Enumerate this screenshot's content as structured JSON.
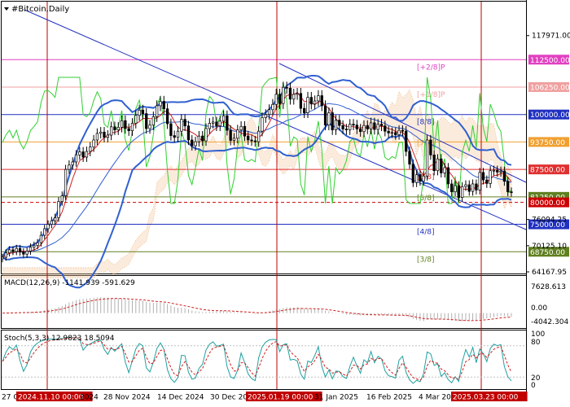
{
  "chart_data": {
    "type": "candlestick",
    "symbol_label": "#Bitcoin,Daily",
    "y_range": [
      64167.95,
      122000
    ],
    "price_ticks": [
      "117971.00",
      "76094.25",
      "70125.10",
      "64167.95"
    ],
    "murrey_levels": [
      {
        "value": 112500,
        "label": "112500.00",
        "tag": "[+2/8]P",
        "color": "#e040c0",
        "dash": false
      },
      {
        "value": 106250,
        "label": "106250.00",
        "tag": "[+1/8]P",
        "color": "#f0a0a0",
        "dash": false
      },
      {
        "value": 100000,
        "label": "100000.00",
        "tag": "[8/8]",
        "color": "#2030c0",
        "dash": false
      },
      {
        "value": 93750,
        "label": "93750.00",
        "tag": "[7/8]",
        "color": "#f0a030",
        "dash": false
      },
      {
        "value": 87500,
        "label": "87500.00",
        "tag": "[6/8]",
        "color": "#e03030",
        "dash": false
      },
      {
        "value": 81250,
        "label": "81250.00",
        "tag": "[5/8]",
        "color": "#608020",
        "dash": false
      },
      {
        "value": 80000,
        "label": "80000.00",
        "tag": "",
        "color": "#cc0000",
        "dash": true
      },
      {
        "value": 75000,
        "label": "75000.00",
        "tag": "[4/8]",
        "color": "#2030c0",
        "dash": false
      },
      {
        "value": 68750,
        "label": "68750.00",
        "tag": "[3/8]",
        "color": "#608020",
        "dash": false
      }
    ],
    "current_price_label": "81250.00",
    "macd": {
      "label": "MACD(12,26,9) -1141.939 -591.629",
      "ticks": [
        "7628.613",
        "0.00",
        "-4042.304"
      ],
      "range": [
        -4042.304,
        7628.613
      ]
    },
    "stoch": {
      "label": "Stoch(5,3,3) 12.9823 18.5094",
      "ticks": [
        "100",
        "80",
        "20",
        "0"
      ]
    },
    "x_labels": [
      "27 O",
      "2024.11.10 00:00",
      "2024",
      "28 Nov 2024",
      "14 Dec 2024",
      "30 Dec 20",
      "2025.01.19 00:00",
      "31 Jan 2025",
      "16 Feb 2025",
      "4 Mar 20",
      "2025.03.23 00:00"
    ],
    "close_prices": [
      67500,
      68500,
      69200,
      68800,
      69500,
      68700,
      68200,
      68900,
      69800,
      70200,
      70800,
      72500,
      74000,
      75000,
      75800,
      76500,
      80200,
      81500,
      87500,
      88500,
      89200,
      90800,
      91500,
      90300,
      91600,
      92600,
      94200,
      95700,
      96000,
      94800,
      95300,
      97200,
      96500,
      97100,
      98600,
      96800,
      96300,
      98000,
      99800,
      101000,
      100200,
      96800,
      97600,
      99500,
      102000,
      103000,
      101300,
      97900,
      95200,
      94800,
      96200,
      98900,
      97400,
      94200,
      92900,
      93800,
      95100,
      94000,
      96800,
      98000,
      98300,
      97400,
      98500,
      99700,
      96400,
      94100,
      94600,
      96500,
      97300,
      95100,
      94200,
      94000,
      93800,
      96200,
      99300,
      100000,
      101100,
      102300,
      104600,
      102500,
      106200,
      106000,
      103500,
      104600,
      104800,
      101400,
      100400,
      103900,
      102400,
      103100,
      104300,
      102000,
      97600,
      100400,
      96500,
      98700,
      97500,
      96700,
      96500,
      97800,
      97600,
      96700,
      96100,
      97500,
      96700,
      98100,
      96600,
      97800,
      97400,
      96200,
      95800,
      95900,
      95400,
      96400,
      96200,
      91600,
      88700,
      84500,
      86300,
      84800,
      86000,
      94200,
      90800,
      87200,
      89900,
      86700,
      87900,
      84200,
      82400,
      83800,
      81100,
      83600,
      84000,
      82500,
      84200,
      82800,
      86800,
      85100,
      84300,
      87200,
      87300,
      86900,
      87100,
      84800,
      82400,
      82300
    ],
    "x_marker_labels": [
      "2024.11.10 00:00",
      "2025.01.19 00:00",
      "2025.03.23 00:00"
    ]
  }
}
